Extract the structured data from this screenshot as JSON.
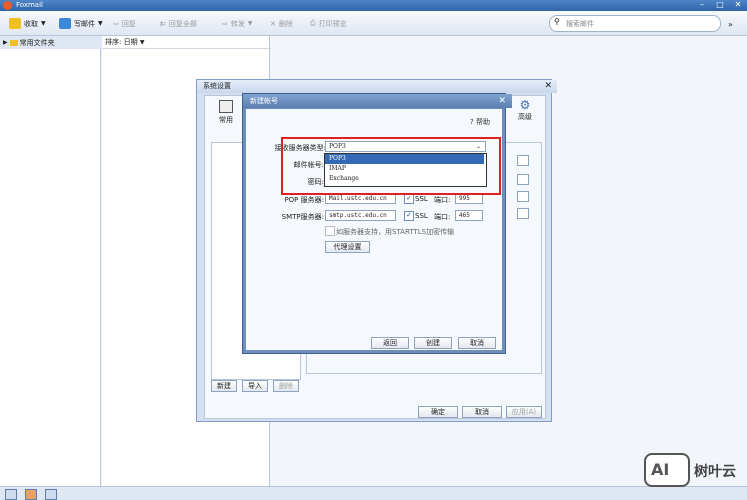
{
  "app": {
    "title": "Foxmail"
  },
  "toolbar": {
    "receive": "收取",
    "compose": "写邮件",
    "reply": "回复",
    "reply_all": "回复全部",
    "forward": "转发",
    "delete": "删除",
    "print_preview": "打印预览",
    "search_placeholder": "搜索邮件"
  },
  "sidebar": {
    "folder_label": "常用文件夹"
  },
  "list": {
    "sort_label": "排序: 日期"
  },
  "settings_dialog": {
    "title": "系统设置",
    "tab_general": "常用",
    "tab_advanced": "高级",
    "btn_new": "新建",
    "btn_import": "导入",
    "btn_delete": "删除",
    "btn_ok": "确定",
    "btn_cancel": "取消",
    "btn_apply": "应用(A)"
  },
  "new_account_dialog": {
    "title": "新建帐号",
    "help": "帮助",
    "server_type_label": "接收服务器类型:",
    "server_type_value": "POP3",
    "server_type_options": [
      "POP3",
      "IMAP",
      "Exchange"
    ],
    "server_type_selected_index": 0,
    "account_label": "邮件帐号:",
    "password_label": "密码:",
    "pop_label": "POP 服务器:",
    "pop_value": "Mail.ustc.edu.cn",
    "pop_ssl": "SSL",
    "pop_port_label": "端口:",
    "pop_port": "995",
    "smtp_label": "SMTP服务器:",
    "smtp_value": "smtp.ustc.edu.cn",
    "smtp_ssl": "SSL",
    "smtp_port_label": "端口:",
    "smtp_port": "465",
    "starttls_text": "如服务器支持，用STARTTLS加密传输",
    "proxy_button": "代理设置",
    "btn_back": "返回",
    "btn_create": "创建",
    "btn_cancel": "取消"
  },
  "watermark": {
    "ai": "AI",
    "brand": "树叶云"
  },
  "colors": {
    "accent": "#3469b5",
    "highlight_box": "#e02020",
    "titlebar": "#2f63a8"
  }
}
